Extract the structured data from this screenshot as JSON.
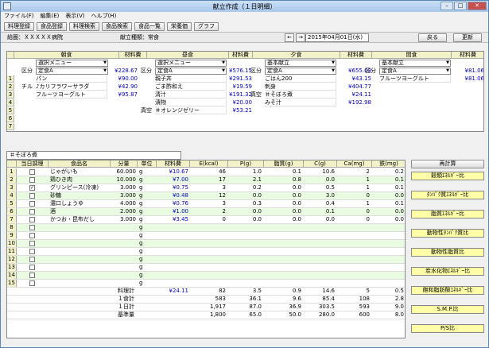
{
  "window": {
    "title": "献立作成（１日明細）"
  },
  "menu": [
    "ファイル(F)",
    "編集(E)",
    "表示(V)",
    "ヘルプ(H)"
  ],
  "toolbar": [
    "料理登録",
    "食品登録",
    "料理検索",
    "食品検索",
    "食品一覧",
    "栄養価",
    "グラフ"
  ],
  "info": {
    "hospital": "給圏：ＸＸＸＸＸ病院",
    "meal_kind": "献立種類：常食",
    "date": "2015年04月01日(水)",
    "nav_prev": "←",
    "nav_next": "→",
    "back": "戻る",
    "update": "更新"
  },
  "meals": {
    "headers": [
      "朝食",
      "材料費",
      "昼食",
      "材料費",
      "夕食",
      "材料費",
      "間食",
      "材料費"
    ],
    "rownums": [
      "1",
      "2",
      "3",
      "4",
      "5",
      "6",
      "7"
    ],
    "kubun_label": "区分",
    "breakfast": {
      "menu": "選択メニュー",
      "kubun": "定食A",
      "cost_total": "¥228.67",
      "items": [
        {
          "pre": "",
          "name": "パン",
          "cost": "¥90.00"
        },
        {
          "pre": "チル",
          "name": "♪カリフラワーサラダ",
          "cost": "¥42.90"
        },
        {
          "pre": "",
          "name": "フルーツヨーグルト",
          "cost": "¥95.87"
        }
      ]
    },
    "lunch": {
      "menu": "選択メニュー",
      "kubun": "定食A",
      "cost_total": "¥576.15",
      "items": [
        {
          "pre": "",
          "name": "親子丼",
          "cost": "¥291.53"
        },
        {
          "pre": "",
          "name": "ごま酢和え",
          "cost": "¥19.59"
        },
        {
          "pre": "",
          "name": "清汁",
          "cost": "¥191.32"
        },
        {
          "pre": "",
          "name": "漬物",
          "cost": "¥20.00"
        },
        {
          "pre": "真空",
          "name": "＃オレンジゼリー",
          "cost": "¥53.21"
        }
      ]
    },
    "dinner": {
      "menu": "基本献立",
      "kubun": "定食A",
      "cost_total": "¥655.03",
      "items": [
        {
          "pre": "",
          "name": "ごはん200",
          "cost": "¥43.15"
        },
        {
          "pre": "",
          "name": "刺身",
          "cost": "¥404.77"
        },
        {
          "pre": "真空",
          "name": "＃そぼろ煮",
          "cost": "¥24.11"
        },
        {
          "pre": "",
          "name": "みそ汁",
          "cost": "¥192.98"
        }
      ]
    },
    "snack": {
      "menu": "基本献立",
      "kubun": "定食A",
      "cost_total": "¥81.06",
      "items": [
        {
          "pre": "",
          "name": "フルーツヨーグルト",
          "cost": "¥81.06"
        }
      ]
    }
  },
  "dish": {
    "name": "＃そぼろ煮"
  },
  "ingredients": {
    "headers": [
      "当日調理",
      "食品名",
      "分量",
      "単位",
      "材料費",
      "E(kcal)",
      "P(g)",
      "脂質(g)",
      "C(g)",
      "Ca(mg)",
      "鉄(mg)"
    ],
    "rows": [
      {
        "no": "1",
        "checked": false,
        "name": "じゃがいも",
        "qty": "60.000",
        "unit": "g",
        "cost": "¥10.67",
        "e": "46",
        "p": "1.0",
        "f": "0.1",
        "c": "10.6",
        "ca": "2",
        "fe": "0.2"
      },
      {
        "no": "2",
        "checked": false,
        "name": "鶏ひき肉",
        "qty": "10.000",
        "unit": "g",
        "cost": "¥7.00",
        "e": "17",
        "p": "2.1",
        "f": "0.8",
        "c": "0.0",
        "ca": "1",
        "fe": "0.1"
      },
      {
        "no": "3",
        "checked": true,
        "name": "グリンピース(冷凍)",
        "qty": "3.000",
        "unit": "g",
        "cost": "¥0.75",
        "e": "3",
        "p": "0.2",
        "f": "0.0",
        "c": "0.5",
        "ca": "1",
        "fe": "0.1"
      },
      {
        "no": "4",
        "checked": false,
        "name": "砂糖",
        "qty": "3.000",
        "unit": "g",
        "cost": "¥0.48",
        "e": "12",
        "p": "0.0",
        "f": "0.0",
        "c": "3.0",
        "ca": "0",
        "fe": "0.0"
      },
      {
        "no": "5",
        "checked": false,
        "name": "濃口しょうゆ",
        "qty": "4.000",
        "unit": "g",
        "cost": "¥0.76",
        "e": "3",
        "p": "0.3",
        "f": "0.0",
        "c": "0.4",
        "ca": "1",
        "fe": "0.1"
      },
      {
        "no": "6",
        "checked": false,
        "name": "酒",
        "qty": "2.000",
        "unit": "g",
        "cost": "¥1.00",
        "e": "2",
        "p": "0.0",
        "f": "0.0",
        "c": "0.1",
        "ca": "0",
        "fe": "0.0"
      },
      {
        "no": "7",
        "checked": false,
        "name": "かつお・昆布だし",
        "qty": "3.000",
        "unit": "g",
        "cost": "¥3.45",
        "e": "0",
        "p": "0.0",
        "f": "0.0",
        "c": "0.0",
        "ca": "0",
        "fe": "0.0"
      },
      {
        "no": "8",
        "checked": false,
        "name": "",
        "qty": "",
        "unit": "g",
        "cost": "",
        "e": "",
        "p": "",
        "f": "",
        "c": "",
        "ca": "",
        "fe": ""
      },
      {
        "no": "9",
        "checked": false,
        "name": "",
        "qty": "",
        "unit": "g",
        "cost": "",
        "e": "",
        "p": "",
        "f": "",
        "c": "",
        "ca": "",
        "fe": ""
      },
      {
        "no": "10",
        "checked": false,
        "name": "",
        "qty": "",
        "unit": "g",
        "cost": "",
        "e": "",
        "p": "",
        "f": "",
        "c": "",
        "ca": "",
        "fe": ""
      },
      {
        "no": "11",
        "checked": false,
        "name": "",
        "qty": "",
        "unit": "g",
        "cost": "",
        "e": "",
        "p": "",
        "f": "",
        "c": "",
        "ca": "",
        "fe": ""
      },
      {
        "no": "12",
        "checked": false,
        "name": "",
        "qty": "",
        "unit": "g",
        "cost": "",
        "e": "",
        "p": "",
        "f": "",
        "c": "",
        "ca": "",
        "fe": ""
      },
      {
        "no": "13",
        "checked": false,
        "name": "",
        "qty": "",
        "unit": "g",
        "cost": "",
        "e": "",
        "p": "",
        "f": "",
        "c": "",
        "ca": "",
        "fe": ""
      },
      {
        "no": "14",
        "checked": false,
        "name": "",
        "qty": "",
        "unit": "g",
        "cost": "",
        "e": "",
        "p": "",
        "f": "",
        "c": "",
        "ca": "",
        "fe": ""
      },
      {
        "no": "15",
        "checked": false,
        "name": "",
        "qty": "",
        "unit": "g",
        "cost": "",
        "e": "",
        "p": "",
        "f": "",
        "c": "",
        "ca": "",
        "fe": ""
      }
    ],
    "totals": [
      {
        "label": "料理計",
        "cost": "¥24.11",
        "e": "82",
        "p": "3.5",
        "f": "0.9",
        "c": "14.6",
        "ca": "5",
        "fe": "0.5"
      },
      {
        "label": "１食計",
        "cost": "",
        "e": "583",
        "p": "36.1",
        "f": "9.6",
        "c": "85.4",
        "ca": "108",
        "fe": "2.8"
      },
      {
        "label": "１日計",
        "cost": "",
        "e": "1,917",
        "p": "87.0",
        "f": "36.9",
        "c": "303.5",
        "ca": "593",
        "fe": "9.0"
      },
      {
        "label": "基準量",
        "cost": "",
        "e": "1,800",
        "p": "65.0",
        "f": "50.0",
        "c": "280.0",
        "ca": "600",
        "fe": "8.0"
      }
    ]
  },
  "right_panel": {
    "recalc": "再計算",
    "ratios": [
      "穀類ｴﾈﾙｷﾞｰ比",
      "ﾀﾝﾊﾟｸ質ｴﾈﾙｷﾞｰ比",
      "脂質ｴﾈﾙｷﾞｰ比",
      "動物性ﾀﾝﾊﾟｸ質比",
      "動物性脂質比",
      "炭水化物ｴﾈﾙｷﾞｰ比",
      "飽和脂肪酸ｴﾈﾙｷﾞｰ比",
      "S.M.P.比",
      "P/S比"
    ]
  }
}
